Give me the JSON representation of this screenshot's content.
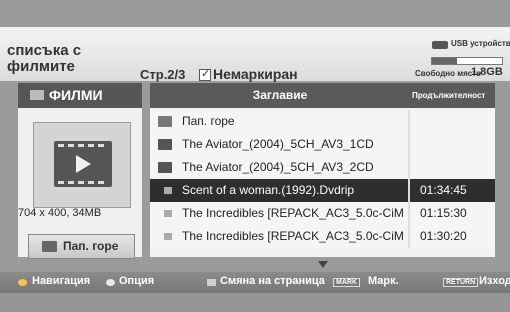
{
  "header": {
    "title_line1": "списъка с",
    "title_line2": "филмите",
    "page_indicator": "Стр.2/3",
    "filter_label": "Немаркиран",
    "usb_label": "USB устройство",
    "usb_fill_fraction": 0.35,
    "free_space_label": "Свободно място",
    "free_space_value": "1.8GB"
  },
  "left_panel": {
    "section_title": "ФИЛМИ",
    "thumbnail_icon": "video-file-icon",
    "resolution_info": "704 x 400, 34MB",
    "up_button_label": "Пап. горе"
  },
  "table": {
    "columns": {
      "title": "Заглавие",
      "duration": "Продължителност"
    },
    "rows": [
      {
        "type": "up",
        "name": "Пап. горе",
        "duration": ""
      },
      {
        "type": "folder",
        "name": "The Aviator_(2004)_5CH_AV3_1CD",
        "duration": ""
      },
      {
        "type": "folder",
        "name": "The Aviator_(2004)_5CH_AV3_2CD",
        "duration": ""
      },
      {
        "type": "file",
        "name": "Scent of a woman.(1992).Dvdrip",
        "duration": "01:34:45",
        "selected": true
      },
      {
        "type": "file",
        "name": "The Incredibles [REPACK_AC3_5.0c-CiM",
        "duration": "01:15:30"
      },
      {
        "type": "file",
        "name": "The Incredibles [REPACK_AC3_5.0c-CiM",
        "duration": "01:30:20"
      }
    ]
  },
  "footer": {
    "navigation": "Навигация",
    "option": "Опция",
    "page_change": "Смяна на страница",
    "mark_key": "MARK",
    "mark": "Марк.",
    "return_key": "RETURN",
    "exit": "Изход"
  }
}
